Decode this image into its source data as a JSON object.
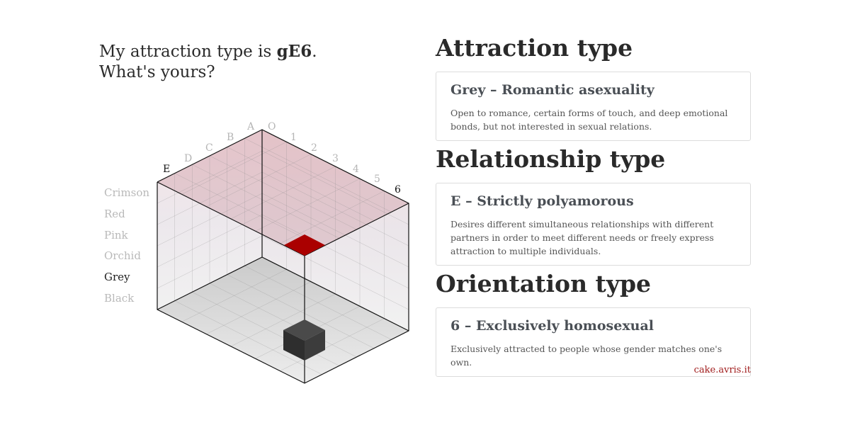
{
  "headline": {
    "prefix": "My attraction type is ",
    "code": "gE6",
    "suffix": ".",
    "line2": "What's yours?"
  },
  "colors": {
    "items": [
      "Crimson",
      "Red",
      "Pink",
      "Orchid",
      "Grey",
      "Black"
    ],
    "active": "Grey"
  },
  "cube": {
    "letters": [
      "E",
      "D",
      "C",
      "B",
      "A",
      "O"
    ],
    "numbers": [
      "1",
      "2",
      "3",
      "4",
      "5",
      "6"
    ],
    "active_letter": "E",
    "active_number": "6",
    "highlight_color": "#aa0000",
    "block_color": "#3a3a3a"
  },
  "sections": [
    {
      "heading": "Attraction type",
      "title": "Grey – Romantic asexuality",
      "description": "Open to romance, certain forms of touch, and deep emotional bonds, but not interested in sexual relations."
    },
    {
      "heading": "Relationship type",
      "title": "E – Strictly polyamorous",
      "description": "Desires different simultaneous relationships with different partners in order to meet different needs or freely express attraction to multiple individuals."
    },
    {
      "heading": "Orientation type",
      "title": "6 – Exclusively homosexual",
      "description": "Exclusively attracted to people whose gender matches one's own."
    }
  ],
  "footer": {
    "link": "cake.avris.it"
  }
}
